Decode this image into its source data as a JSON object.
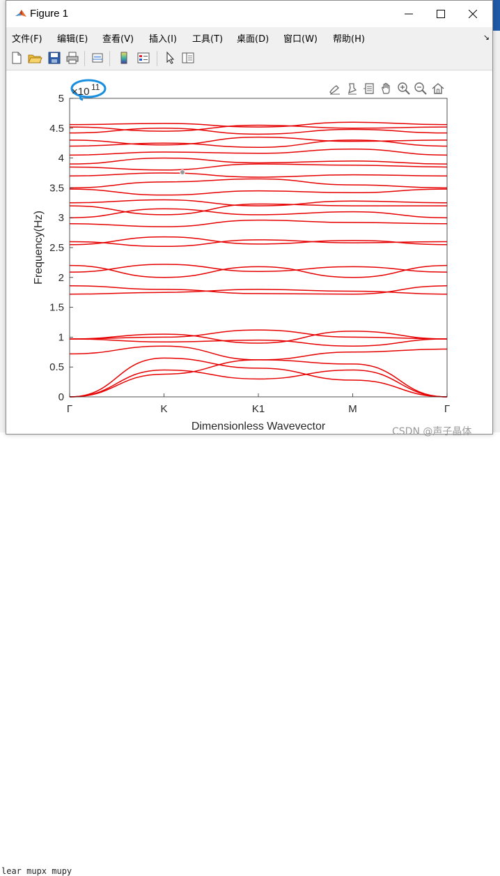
{
  "window": {
    "title": "Figure 1",
    "menu": [
      {
        "label": "文件(F)"
      },
      {
        "label": "编辑(E)"
      },
      {
        "label": "查看(V)"
      },
      {
        "label": "插入(I)"
      },
      {
        "label": "工具(T)"
      },
      {
        "label": "桌面(D)"
      },
      {
        "label": "窗口(W)"
      },
      {
        "label": "帮助(H)"
      }
    ],
    "menu_overflow": "↘",
    "toolbar_icons": [
      "new-figure-icon",
      "open-file-icon",
      "save-icon",
      "print-icon",
      "link-plot-icon",
      "insert-colorbar-icon",
      "insert-legend-icon",
      "edit-plot-arrow-icon",
      "property-inspector-icon"
    ],
    "axes_toolbar_icons": [
      "brush-icon",
      "data-tips-icon",
      "rotate-icon",
      "pan-hand-icon",
      "zoom-in-icon",
      "zoom-out-icon",
      "home-icon"
    ]
  },
  "background": {
    "code_line": "lear mupx mupy",
    "watermark": "CSDN @声子晶体"
  },
  "chart_data": {
    "type": "line",
    "xlabel": "Dimensionless Wavevector",
    "ylabel": "Frequency(Hz)",
    "exponent_label": "×10",
    "exponent_power": "11",
    "x_ticks": [
      "Γ",
      "K",
      "K1",
      "M",
      "Γ"
    ],
    "x_tick_positions": [
      0,
      1,
      2,
      3,
      4
    ],
    "y_ticks": [
      "0",
      "0.5",
      "1",
      "1.5",
      "2",
      "2.5",
      "3",
      "3.5",
      "4",
      "4.5",
      "5"
    ],
    "y_tick_values": [
      0,
      0.5,
      1,
      1.5,
      2,
      2.5,
      3,
      3.5,
      4,
      4.5,
      5
    ],
    "ylim": [
      0,
      5
    ],
    "xlim": [
      0,
      4
    ],
    "line_color": "#e60000",
    "grid": false,
    "series": [
      {
        "values": [
          0,
          0.38,
          0.62,
          0.55,
          0
        ]
      },
      {
        "values": [
          0,
          0.45,
          0.3,
          0.45,
          0
        ]
      },
      {
        "values": [
          0,
          0.65,
          0.48,
          0.28,
          0
        ]
      },
      {
        "values": [
          0.72,
          0.85,
          0.62,
          0.75,
          0.8
        ]
      },
      {
        "values": [
          0.97,
          0.92,
          0.95,
          0.85,
          0.97
        ]
      },
      {
        "values": [
          0.97,
          1.05,
          0.9,
          1.1,
          0.97
        ]
      },
      {
        "values": [
          0.97,
          1.0,
          1.12,
          1.0,
          0.97
        ]
      },
      {
        "values": [
          1.72,
          1.75,
          1.8,
          1.77,
          1.72
        ]
      },
      {
        "values": [
          1.86,
          1.8,
          1.73,
          1.72,
          1.86
        ]
      },
      {
        "values": [
          2.09,
          2.22,
          2.1,
          2.18,
          2.09
        ]
      },
      {
        "values": [
          2.2,
          2.0,
          2.18,
          2.0,
          2.2
        ]
      },
      {
        "values": [
          2.55,
          2.68,
          2.56,
          2.62,
          2.55
        ]
      },
      {
        "values": [
          2.6,
          2.52,
          2.63,
          2.58,
          2.6
        ]
      },
      {
        "values": [
          2.9,
          2.85,
          2.96,
          2.92,
          2.9
        ]
      },
      {
        "values": [
          3.0,
          3.15,
          3.05,
          3.1,
          3.0
        ]
      },
      {
        "values": [
          3.2,
          3.05,
          3.23,
          3.2,
          3.2
        ]
      },
      {
        "values": [
          3.25,
          3.3,
          3.2,
          3.28,
          3.25
        ]
      },
      {
        "values": [
          3.48,
          3.38,
          3.45,
          3.42,
          3.48
        ]
      },
      {
        "values": [
          3.5,
          3.6,
          3.65,
          3.55,
          3.5
        ]
      },
      {
        "values": [
          3.7,
          3.75,
          3.68,
          3.72,
          3.7
        ]
      },
      {
        "values": [
          3.85,
          3.8,
          3.9,
          3.88,
          3.85
        ]
      },
      {
        "values": [
          3.9,
          4.0,
          3.92,
          3.95,
          3.9
        ]
      },
      {
        "values": [
          4.05,
          4.1,
          4.08,
          4.15,
          4.05
        ]
      },
      {
        "values": [
          4.2,
          4.25,
          4.18,
          4.3,
          4.2
        ]
      },
      {
        "values": [
          4.3,
          4.22,
          4.35,
          4.28,
          4.3
        ]
      },
      {
        "values": [
          4.42,
          4.5,
          4.4,
          4.48,
          4.42
        ]
      },
      {
        "values": [
          4.52,
          4.45,
          4.55,
          4.5,
          4.52
        ]
      },
      {
        "values": [
          4.56,
          4.58,
          4.52,
          4.6,
          4.56
        ]
      }
    ]
  }
}
